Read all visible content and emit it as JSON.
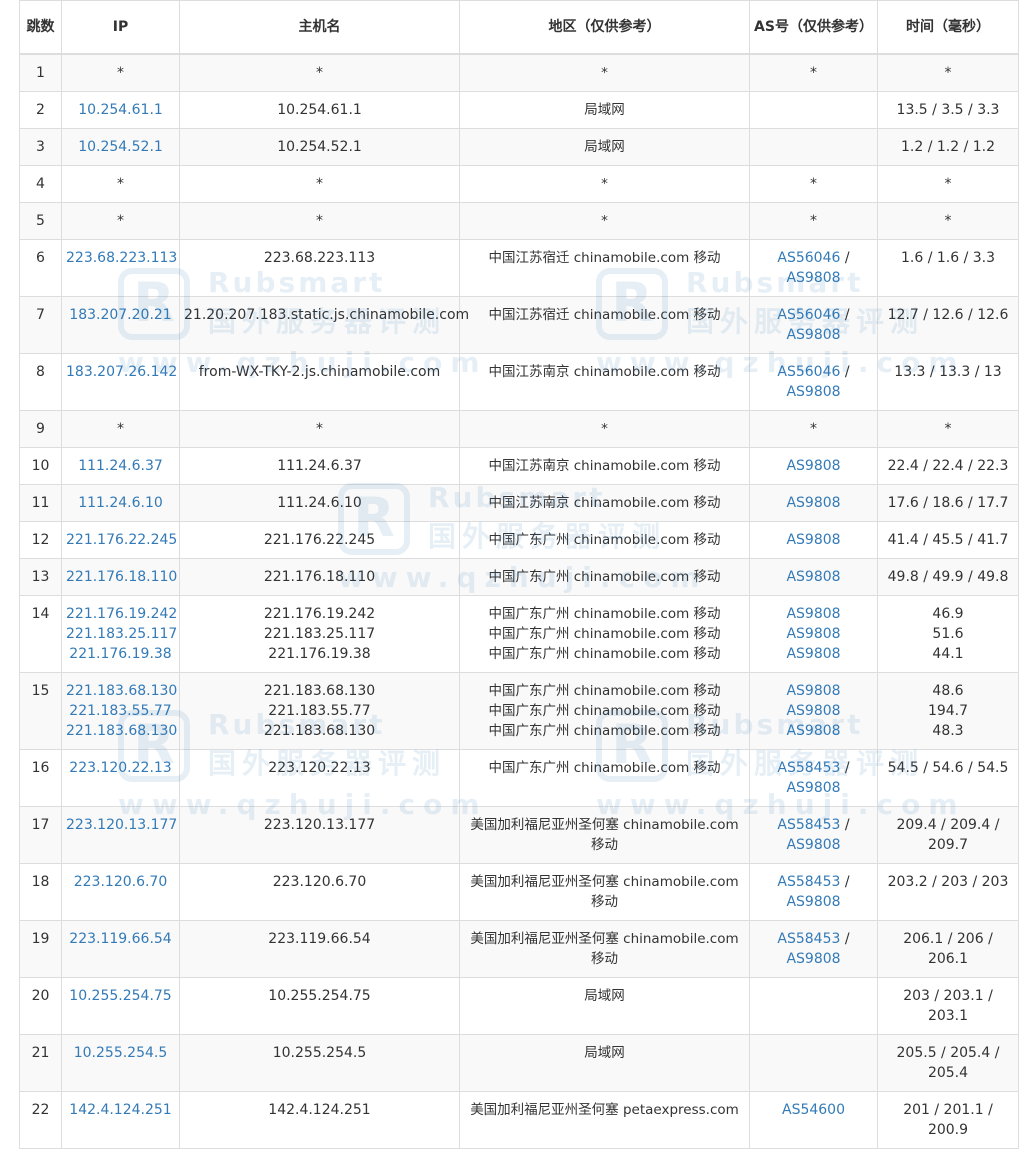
{
  "headers": {
    "hop": "跳数",
    "ip": "IP",
    "host": "主机名",
    "region": "地区（仅供参考）",
    "as": "AS号（仅供参考）",
    "time": "时间（毫秒）"
  },
  "rows": [
    {
      "hop": "1",
      "ips": [
        "*"
      ],
      "hosts": [
        "*"
      ],
      "regions": [
        "*"
      ],
      "as": [
        {
          "items": [
            "*"
          ],
          "plain": true
        }
      ],
      "times": [
        "*"
      ]
    },
    {
      "hop": "2",
      "ips": [
        "10.254.61.1"
      ],
      "hosts": [
        "10.254.61.1"
      ],
      "regions": [
        "局域网"
      ],
      "as": [],
      "times": [
        "13.5 / 3.5 / 3.3"
      ]
    },
    {
      "hop": "3",
      "ips": [
        "10.254.52.1"
      ],
      "hosts": [
        "10.254.52.1"
      ],
      "regions": [
        "局域网"
      ],
      "as": [],
      "times": [
        "1.2 / 1.2 / 1.2"
      ]
    },
    {
      "hop": "4",
      "ips": [
        "*"
      ],
      "hosts": [
        "*"
      ],
      "regions": [
        "*"
      ],
      "as": [
        {
          "items": [
            "*"
          ],
          "plain": true
        }
      ],
      "times": [
        "*"
      ]
    },
    {
      "hop": "5",
      "ips": [
        "*"
      ],
      "hosts": [
        "*"
      ],
      "regions": [
        "*"
      ],
      "as": [
        {
          "items": [
            "*"
          ],
          "plain": true
        }
      ],
      "times": [
        "*"
      ]
    },
    {
      "hop": "6",
      "ips": [
        "223.68.223.113"
      ],
      "hosts": [
        "223.68.223.113"
      ],
      "regions": [
        "中国江苏宿迁 chinamobile.com 移动"
      ],
      "as": [
        {
          "items": [
            "AS56046",
            "AS9808"
          ]
        }
      ],
      "times": [
        "1.6 / 1.6 / 3.3"
      ]
    },
    {
      "hop": "7",
      "ips": [
        "183.207.20.21"
      ],
      "hosts": [
        "21.20.207.183.static.js.chinamobile.com"
      ],
      "regions": [
        "中国江苏宿迁 chinamobile.com 移动"
      ],
      "as": [
        {
          "items": [
            "AS56046",
            "AS9808"
          ]
        }
      ],
      "times": [
        "12.7 / 12.6 / 12.6"
      ]
    },
    {
      "hop": "8",
      "ips": [
        "183.207.26.142"
      ],
      "hosts": [
        "from-WX-TKY-2.js.chinamobile.com"
      ],
      "regions": [
        "中国江苏南京 chinamobile.com 移动"
      ],
      "as": [
        {
          "items": [
            "AS56046",
            "AS9808"
          ]
        }
      ],
      "times": [
        "13.3 / 13.3 / 13"
      ]
    },
    {
      "hop": "9",
      "ips": [
        "*"
      ],
      "hosts": [
        "*"
      ],
      "regions": [
        "*"
      ],
      "as": [
        {
          "items": [
            "*"
          ],
          "plain": true
        }
      ],
      "times": [
        "*"
      ]
    },
    {
      "hop": "10",
      "ips": [
        "111.24.6.37"
      ],
      "hosts": [
        "111.24.6.37"
      ],
      "regions": [
        "中国江苏南京 chinamobile.com 移动"
      ],
      "as": [
        {
          "items": [
            "AS9808"
          ]
        }
      ],
      "times": [
        "22.4 / 22.4 / 22.3"
      ]
    },
    {
      "hop": "11",
      "ips": [
        "111.24.6.10"
      ],
      "hosts": [
        "111.24.6.10"
      ],
      "regions": [
        "中国江苏南京 chinamobile.com 移动"
      ],
      "as": [
        {
          "items": [
            "AS9808"
          ]
        }
      ],
      "times": [
        "17.6 / 18.6 / 17.7"
      ]
    },
    {
      "hop": "12",
      "ips": [
        "221.176.22.245"
      ],
      "hosts": [
        "221.176.22.245"
      ],
      "regions": [
        "中国广东广州 chinamobile.com 移动"
      ],
      "as": [
        {
          "items": [
            "AS9808"
          ]
        }
      ],
      "times": [
        "41.4 / 45.5 / 41.7"
      ]
    },
    {
      "hop": "13",
      "ips": [
        "221.176.18.110"
      ],
      "hosts": [
        "221.176.18.110"
      ],
      "regions": [
        "中国广东广州 chinamobile.com 移动"
      ],
      "as": [
        {
          "items": [
            "AS9808"
          ]
        }
      ],
      "times": [
        "49.8 / 49.9 / 49.8"
      ]
    },
    {
      "hop": "14",
      "ips": [
        "221.176.19.242",
        "221.183.25.117",
        "221.176.19.38"
      ],
      "hosts": [
        "221.176.19.242",
        "221.183.25.117",
        "221.176.19.38"
      ],
      "regions": [
        "中国广东广州 chinamobile.com 移动",
        "中国广东广州 chinamobile.com 移动",
        "中国广东广州 chinamobile.com 移动"
      ],
      "as": [
        {
          "items": [
            "AS9808"
          ]
        },
        {
          "items": [
            "AS9808"
          ]
        },
        {
          "items": [
            "AS9808"
          ]
        }
      ],
      "times": [
        "46.9",
        "51.6",
        "44.1"
      ]
    },
    {
      "hop": "15",
      "ips": [
        "221.183.68.130",
        "221.183.55.77",
        "221.183.68.130"
      ],
      "hosts": [
        "221.183.68.130",
        "221.183.55.77",
        "221.183.68.130"
      ],
      "regions": [
        "中国广东广州 chinamobile.com 移动",
        "中国广东广州 chinamobile.com 移动",
        "中国广东广州 chinamobile.com 移动"
      ],
      "as": [
        {
          "items": [
            "AS9808"
          ]
        },
        {
          "items": [
            "AS9808"
          ]
        },
        {
          "items": [
            "AS9808"
          ]
        }
      ],
      "times": [
        "48.6",
        "194.7",
        "48.3"
      ]
    },
    {
      "hop": "16",
      "ips": [
        "223.120.22.13"
      ],
      "hosts": [
        "223.120.22.13"
      ],
      "regions": [
        "中国广东广州 chinamobile.com 移动"
      ],
      "as": [
        {
          "items": [
            "AS58453",
            "AS9808"
          ]
        }
      ],
      "times": [
        "54.5 / 54.6 / 54.5"
      ]
    },
    {
      "hop": "17",
      "ips": [
        "223.120.13.177"
      ],
      "hosts": [
        "223.120.13.177"
      ],
      "regions": [
        "美国加利福尼亚州圣何塞 chinamobile.com 移动"
      ],
      "as": [
        {
          "items": [
            "AS58453",
            "AS9808"
          ]
        }
      ],
      "times": [
        "209.4 / 209.4 / 209.7"
      ]
    },
    {
      "hop": "18",
      "ips": [
        "223.120.6.70"
      ],
      "hosts": [
        "223.120.6.70"
      ],
      "regions": [
        "美国加利福尼亚州圣何塞 chinamobile.com 移动"
      ],
      "as": [
        {
          "items": [
            "AS58453",
            "AS9808"
          ]
        }
      ],
      "times": [
        "203.2 / 203 / 203"
      ]
    },
    {
      "hop": "19",
      "ips": [
        "223.119.66.54"
      ],
      "hosts": [
        "223.119.66.54"
      ],
      "regions": [
        "美国加利福尼亚州圣何塞 chinamobile.com 移动"
      ],
      "as": [
        {
          "items": [
            "AS58453",
            "AS9808"
          ]
        }
      ],
      "times": [
        "206.1 / 206 / 206.1"
      ]
    },
    {
      "hop": "20",
      "ips": [
        "10.255.254.75"
      ],
      "hosts": [
        "10.255.254.75"
      ],
      "regions": [
        "局域网"
      ],
      "as": [],
      "times": [
        "203 / 203.1 / 203.1"
      ]
    },
    {
      "hop": "21",
      "ips": [
        "10.255.254.5"
      ],
      "hosts": [
        "10.255.254.5"
      ],
      "regions": [
        "局域网"
      ],
      "as": [],
      "times": [
        "205.5 / 205.4 / 205.4"
      ]
    },
    {
      "hop": "22",
      "ips": [
        "142.4.124.251"
      ],
      "hosts": [
        "142.4.124.251"
      ],
      "regions": [
        "美国加利福尼亚州圣何塞 petaexpress.com"
      ],
      "as": [
        {
          "items": [
            "AS54600"
          ]
        }
      ],
      "times": [
        "201 / 201.1 / 200.9"
      ]
    }
  ],
  "watermark": {
    "logo": "R",
    "brand": "Rubsmart",
    "cn": "国外服务器评测",
    "url": "www.qzhuji.com"
  },
  "colors": {
    "link": "#337ab7",
    "border": "#dddddd",
    "stripe": "#f9f9f9"
  }
}
